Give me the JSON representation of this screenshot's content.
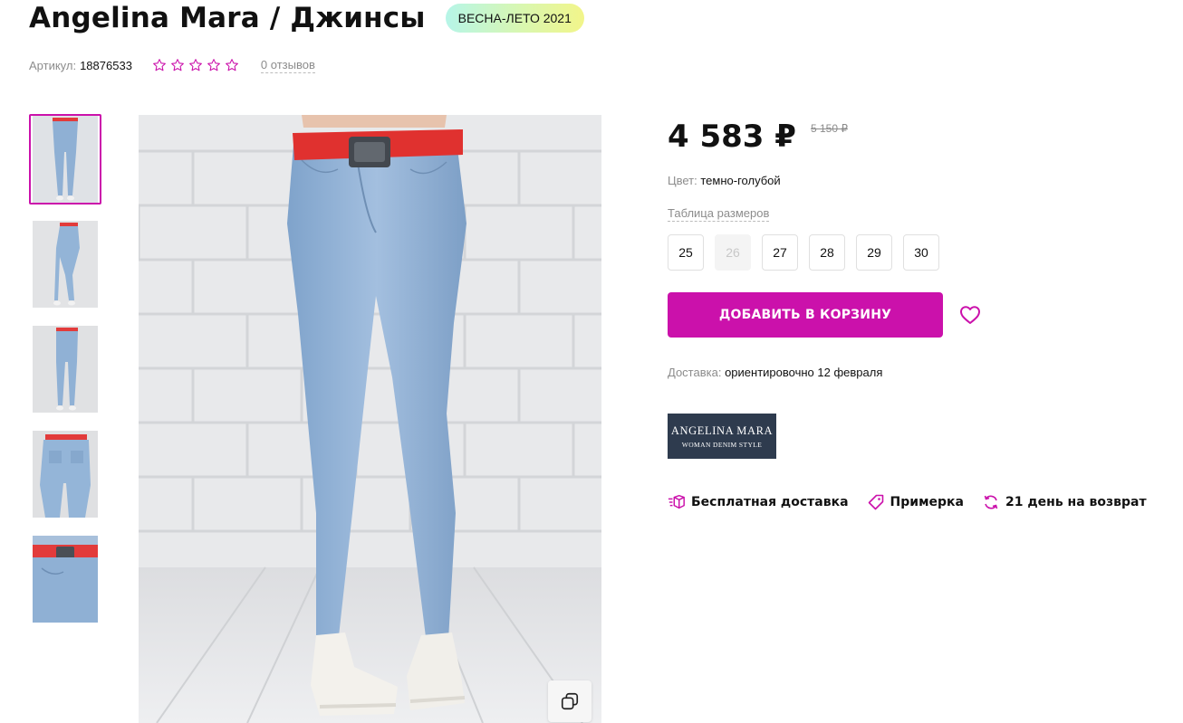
{
  "product": {
    "title": "Angelina Mara / Джинсы",
    "season_badge": "ВЕСНА-ЛЕТО 2021",
    "article_label": "Артикул:",
    "article_value": "18876533",
    "rating_stars": 0,
    "reviews_link": "0 отзывов"
  },
  "gallery": {
    "thumbnails": [
      "front view",
      "side view",
      "front view 2",
      "back view",
      "belt close-up"
    ],
    "active_index": 0
  },
  "pricing": {
    "price": "4 583 ₽",
    "old_price": "5 150 ₽"
  },
  "color": {
    "label": "Цвет:",
    "value": "темно-голубой"
  },
  "sizes": {
    "table_link": "Таблица размеров",
    "items": [
      {
        "label": "25",
        "available": true
      },
      {
        "label": "26",
        "available": false
      },
      {
        "label": "27",
        "available": true
      },
      {
        "label": "28",
        "available": true
      },
      {
        "label": "29",
        "available": true
      },
      {
        "label": "30",
        "available": true
      }
    ]
  },
  "cart": {
    "add_label": "ДОБАВИТЬ В КОРЗИНУ"
  },
  "delivery": {
    "label": "Доставка:",
    "value": "ориентировочно 12 февраля"
  },
  "brand": {
    "name": "ANGELINA MARA",
    "tagline": "WOMAN DENIM STYLE"
  },
  "benefits": [
    {
      "icon": "delivery-truck-icon",
      "label": "Бесплатная доставка"
    },
    {
      "icon": "price-tag-icon",
      "label": "Примерка"
    },
    {
      "icon": "refresh-icon",
      "label": "21 день на возврат"
    }
  ],
  "colors": {
    "accent": "#cb11ab",
    "brand_logo_bg": "#2e3b4e",
    "text_muted": "#8c8c8c"
  }
}
